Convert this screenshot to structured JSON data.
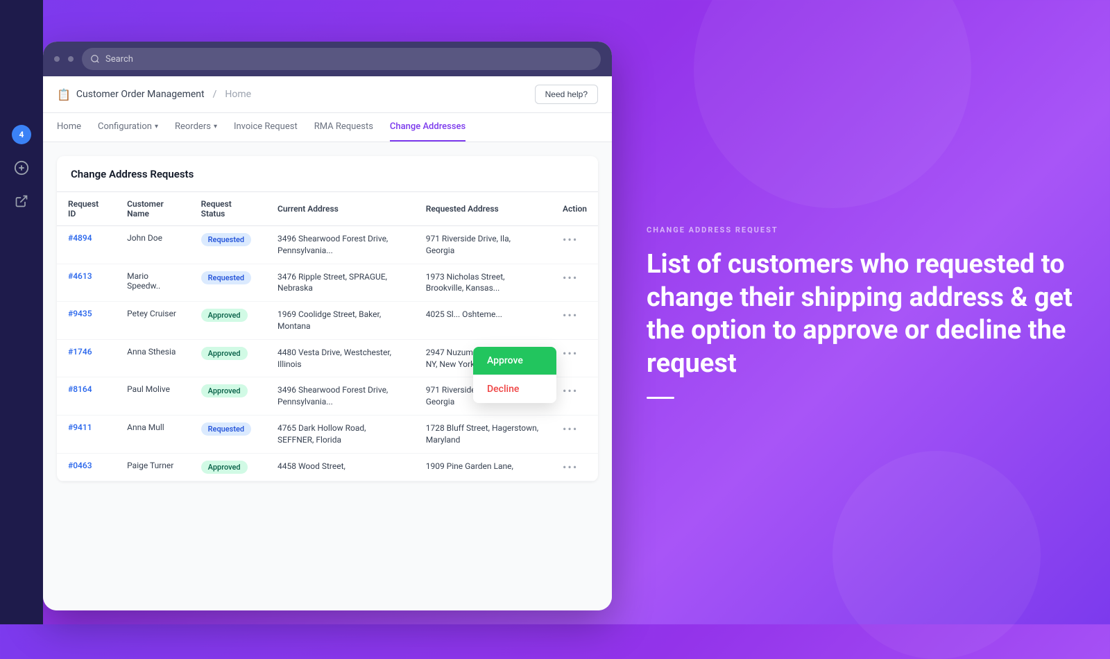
{
  "sidebar": {
    "badge_count": "4",
    "icons": [
      "plus-circle",
      "external-link"
    ]
  },
  "browser": {
    "search_placeholder": "Search"
  },
  "app": {
    "title": "Customer Order Management",
    "breadcrumb_sep": "/",
    "breadcrumb_home": "Home",
    "help_button": "Need help?",
    "title_icon": "📋"
  },
  "nav": {
    "tabs": [
      {
        "label": "Home",
        "active": false,
        "dropdown": false
      },
      {
        "label": "Configuration",
        "active": false,
        "dropdown": true
      },
      {
        "label": "Reorders",
        "active": false,
        "dropdown": true
      },
      {
        "label": "Invoice Request",
        "active": false,
        "dropdown": false
      },
      {
        "label": "RMA Requests",
        "active": false,
        "dropdown": false
      },
      {
        "label": "Change Addresses",
        "active": true,
        "dropdown": false
      }
    ]
  },
  "table": {
    "title": "Change Address Requests",
    "columns": [
      "Request ID",
      "Customer Name",
      "Request Status",
      "Current Address",
      "Requested Address",
      "Action"
    ],
    "rows": [
      {
        "id": "#4894",
        "name": "John Doe",
        "status": "Requested",
        "status_type": "requested",
        "current_address": "3496  Shearwood Forest Drive, Pennsylvania...",
        "requested_address": "971  Riverside Drive, Ila, Georgia"
      },
      {
        "id": "#4613",
        "name": "Mario Speedw..",
        "status": "Requested",
        "status_type": "requested",
        "current_address": "3476  Ripple Street, SPRAGUE, Nebraska",
        "requested_address": "1973  Nicholas Street, Brookville, Kansas..."
      },
      {
        "id": "#9435",
        "name": "Petey Cruiser",
        "status": "Approved",
        "status_type": "approved",
        "current_address": "1969  Coolidge Street, Baker, Montana",
        "requested_address": "4025  Sl... Oshteme..."
      },
      {
        "id": "#1746",
        "name": "Anna Sthesia",
        "status": "Approved",
        "status_type": "approved",
        "current_address": "4480  Vesta Drive, Westchester, Illinois",
        "requested_address": "2947  Nuzum Court, Buffalo, NY, New York"
      },
      {
        "id": "#8164",
        "name": "Paul Molive",
        "status": "Approved",
        "status_type": "approved",
        "current_address": "3496  Shearwood Forest Drive, Pennsylvania...",
        "requested_address": "971  Riverside Drive, Ila, Georgia"
      },
      {
        "id": "#9411",
        "name": "Anna Mull",
        "status": "Requested",
        "status_type": "requested",
        "current_address": "4765  Dark Hollow Road, SEFFNER, Florida",
        "requested_address": "1728  Bluff Street, Hagerstown, Maryland"
      },
      {
        "id": "#0463",
        "name": "Paige Turner",
        "status": "Approved",
        "status_type": "approved",
        "current_address": "4458  Wood Street,",
        "requested_address": "1909  Pine Garden Lane,"
      }
    ]
  },
  "dropdown_menu": {
    "approve_label": "Approve",
    "decline_label": "Decline"
  },
  "info_panel": {
    "label": "CHANGE ADDRESS REQUEST",
    "heading": "List of customers who requested to change their shipping address & get the option to approve or decline the request"
  }
}
